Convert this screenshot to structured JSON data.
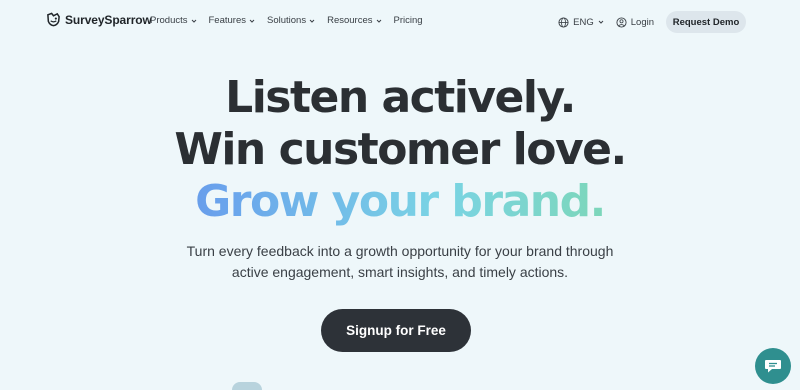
{
  "nav": {
    "brand": "SurveySparrow",
    "menu": [
      "Products",
      "Features",
      "Solutions",
      "Resources",
      "Pricing"
    ],
    "language": "ENG",
    "login": "Login",
    "cta": "Request Demo"
  },
  "hero": {
    "line1": "Listen actively.",
    "line2": "Win customer love.",
    "line3": "Grow your brand.",
    "subtitle_line1": "Turn every feedback into a growth opportunity for your brand through",
    "subtitle_line2": "active engagement, smart insights, and timely actions.",
    "signup": "Signup for Free"
  },
  "colors": {
    "background": "#eef7fa",
    "heading": "#2b2f33",
    "gradient": [
      "#5d74df",
      "#6aa4ec",
      "#7ad4e4",
      "#7fd89c"
    ],
    "cta": "#2d3238",
    "chat": "#2f8f8f"
  },
  "icons": [
    "surveysparrow-logo-icon",
    "chevron-down-icon",
    "globe-icon",
    "user-icon",
    "chat-icon"
  ]
}
